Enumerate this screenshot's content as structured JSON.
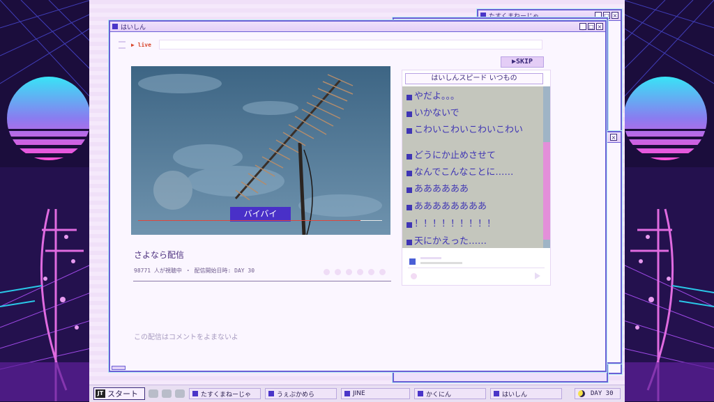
{
  "windows": {
    "main_title": "はいしん",
    "back_title": "たすくまねーじゃ"
  },
  "stream": {
    "status": "▶ live",
    "skip_label": "▶SKIP",
    "caption": "バイバイ",
    "progress": 0.91,
    "title": "さよなら配信",
    "meta": "98771 人が視聴中 ・ 配信開始日時: DAY 30",
    "notice": "この配信はコメントをよまないよ"
  },
  "chat": {
    "header": "はいしんスピード いつもの",
    "messages": [
      "やだよ。。。",
      "いかないで",
      "こわいこわいこわいこわい",
      "どうにか止めさせて",
      "なんでこんなことに……",
      "ああああああ",
      "ああああああああ",
      "！！！！！！！！！",
      "天にかえった……"
    ]
  },
  "taskbar": {
    "start_label": "スタート",
    "tasks": [
      "たすくまねーじゃ",
      "うぇぶかめら",
      "JINE",
      "かくにん",
      "はいしん"
    ],
    "day": "DAY 30"
  },
  "colors": {
    "accent": "#4930c8",
    "window_border": "#6b5fd6",
    "chat_text": "#3f35b4",
    "live_red": "#d8482d"
  },
  "icons": {
    "tray": [
      "twitter-icon",
      "chat-icon",
      "monitor-icon"
    ]
  }
}
